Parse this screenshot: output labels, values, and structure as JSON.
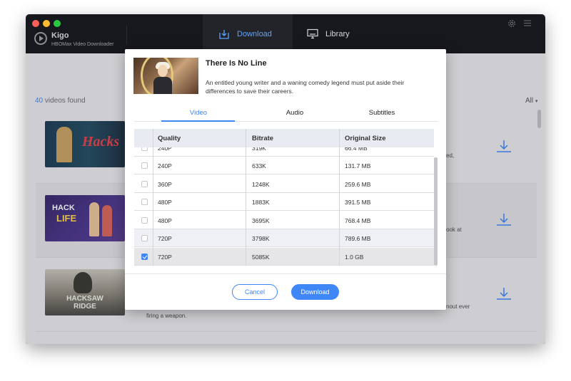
{
  "window": {
    "app_name": "Kigo",
    "app_subtitle": "HBOMax Video Downloader",
    "nav": {
      "download": "Download",
      "library": "Library"
    }
  },
  "list": {
    "count": "40",
    "found_label": " videos found",
    "filter": "All",
    "rows": [
      {
        "thumb_text": "Hacks",
        "desc_tail": "ed,"
      },
      {
        "thumb_text_1": "HACK",
        "thumb_text_2": "LIFE",
        "desc_tail": "ook at"
      },
      {
        "thumb_text": "HACKSAW RIDGE",
        "desc_tail": "nout ever",
        "desc_line": "firing a weapon."
      }
    ]
  },
  "dialog": {
    "title": "There Is No Line",
    "description": "An entitled young writer and a waning comedy legend must put aside their differences to save their careers.",
    "tabs": [
      "Video",
      "Audio",
      "Subtitles"
    ],
    "active_tab": "Video",
    "columns": [
      "Quality",
      "Bitrate",
      "Original Size"
    ],
    "partial_row": {
      "quality": "240P",
      "bitrate": "319K",
      "size": "66.4 MB"
    },
    "rows": [
      {
        "quality": "240P",
        "bitrate": "633K",
        "size": "131.7 MB",
        "checked": false
      },
      {
        "quality": "360P",
        "bitrate": "1248K",
        "size": "259.6 MB",
        "checked": false
      },
      {
        "quality": "480P",
        "bitrate": "1883K",
        "size": "391.5 MB",
        "checked": false
      },
      {
        "quality": "480P",
        "bitrate": "3695K",
        "size": "768.4 MB",
        "checked": false
      },
      {
        "quality": "720P",
        "bitrate": "3798K",
        "size": "789.6 MB",
        "checked": false
      },
      {
        "quality": "720P",
        "bitrate": "5085K",
        "size": "1.0 GB",
        "checked": true
      }
    ],
    "cancel_label": "Cancel",
    "download_label": "Download"
  },
  "colors": {
    "accent": "#3f86f7",
    "titlebar": "#17181d"
  },
  "icons": [
    "settings-gear-icon",
    "menu-icon",
    "download-tab-icon",
    "library-monitor-icon",
    "download-arrow-icon"
  ]
}
